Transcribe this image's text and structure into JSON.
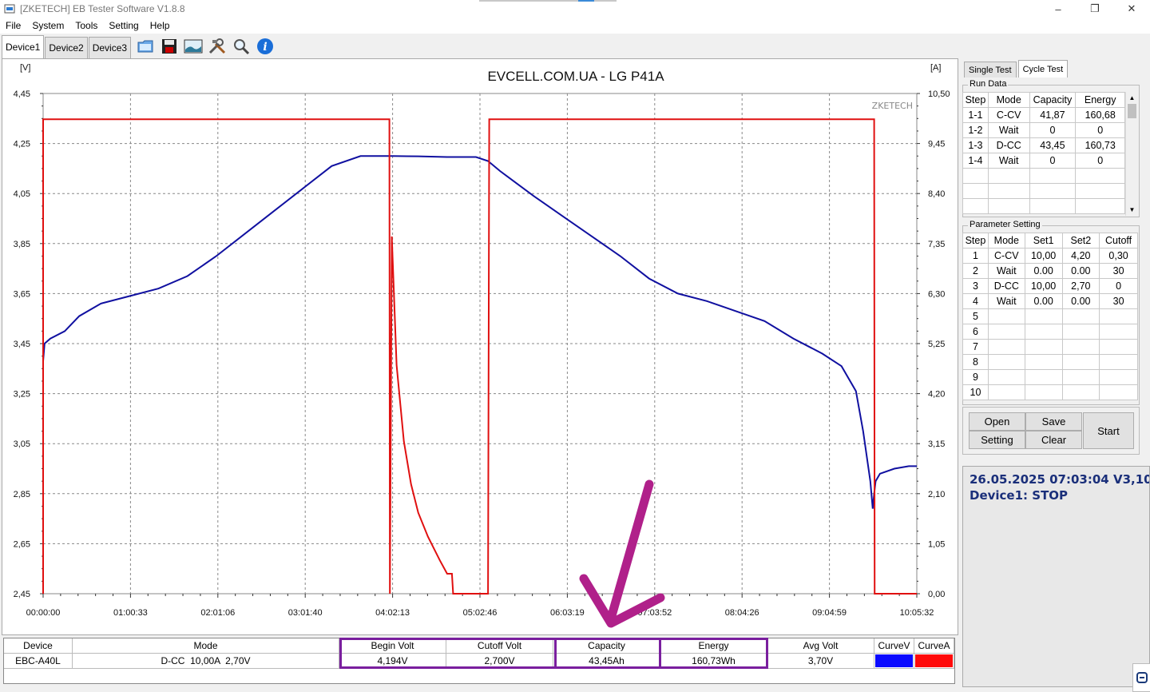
{
  "window": {
    "title": "[ZKETECH] EB Tester Software V1.8.8",
    "controls": [
      "–",
      "❐",
      "✕"
    ]
  },
  "menu": [
    "File",
    "System",
    "Tools",
    "Setting",
    "Help"
  ],
  "device_tabs": [
    "Device1",
    "Device2",
    "Device3"
  ],
  "toolbar_icons": [
    "folder-icon",
    "save-icon",
    "image-icon",
    "tools-icon",
    "search-icon",
    "info-icon"
  ],
  "colors": {
    "curve_v": "#1010a0",
    "curve_a": "#e01010",
    "curve_v_legend": "#0a0aff",
    "curve_a_legend": "#ff0a0a",
    "highlight": "#7a1f9e",
    "arrow": "#b0208a"
  },
  "chart_data": {
    "type": "line",
    "title": "EVCELL.COM.UA - LG P41A",
    "watermark": "ZKETECH",
    "ylabel": "[V]",
    "y2label": "[A]",
    "ylim": [
      2.45,
      4.45
    ],
    "y2lim": [
      0,
      10.5
    ],
    "yticks": [
      "4,45",
      "4,25",
      "4,05",
      "3,85",
      "3,65",
      "3,45",
      "3,25",
      "3,05",
      "2,85",
      "2,65",
      "2,45"
    ],
    "y2ticks": [
      "10,50",
      "9,45",
      "8,40",
      "7,35",
      "6,30",
      "5,25",
      "4,20",
      "3,15",
      "2,10",
      "1,05",
      "0,00"
    ],
    "xticks": [
      "00:00:00",
      "01:00:33",
      "02:01:06",
      "03:01:40",
      "04:02:13",
      "05:02:46",
      "06:03:19",
      "07:03:52",
      "08:04:26",
      "09:04:59",
      "10:05:32"
    ],
    "xlim_seconds": [
      0,
      36332
    ],
    "grid": true,
    "series": [
      {
        "axis": "left",
        "x": [
          0,
          60,
          300,
          900,
          1500,
          2400,
          3600,
          4800,
          6000,
          7200,
          8400,
          9600,
          10800,
          12000,
          13200,
          14400,
          14500,
          15600,
          16800,
          17300,
          18000,
          18500,
          19000,
          19700,
          20400,
          21600,
          22800,
          24000,
          25200,
          26400,
          27600,
          28800,
          30000,
          31200,
          32400,
          33200,
          33800,
          34100,
          34400,
          34500,
          34560,
          34620,
          34800,
          35400,
          36000,
          36332
        ],
        "y": [
          3.38,
          3.45,
          3.47,
          3.5,
          3.56,
          3.61,
          3.64,
          3.67,
          3.72,
          3.8,
          3.89,
          3.98,
          4.07,
          4.16,
          4.2,
          4.2,
          4.2,
          4.199,
          4.196,
          4.196,
          4.196,
          4.18,
          4.14,
          4.09,
          4.04,
          3.96,
          3.88,
          3.8,
          3.71,
          3.65,
          3.62,
          3.58,
          3.54,
          3.47,
          3.41,
          3.36,
          3.26,
          3.1,
          2.9,
          2.79,
          2.85,
          2.9,
          2.93,
          2.95,
          2.96,
          2.96
        ]
      },
      {
        "axis": "right",
        "x": [
          0,
          0,
          14400,
          14420,
          14500,
          14700,
          15000,
          15300,
          15600,
          16000,
          16500,
          16800,
          17000,
          17050,
          17100,
          18500,
          18550,
          34560,
          34580,
          36332
        ],
        "y": [
          0,
          9.96,
          9.96,
          0,
          7.5,
          4.8,
          3.2,
          2.3,
          1.7,
          1.2,
          0.7,
          0.42,
          0.42,
          0,
          0,
          0,
          9.96,
          9.96,
          0,
          0
        ]
      }
    ]
  },
  "bottom_table": {
    "headers": [
      "Device",
      "Mode",
      "Begin Volt",
      "Cutoff Volt",
      "Capacity",
      "Energy",
      "Avg Volt",
      "CurveV",
      "CurveA"
    ],
    "row": [
      "EBC-A40L",
      "D-CC  10,00A  2,70V",
      "4,194V",
      "2,700V",
      "43,45Ah",
      "160,73Wh",
      "3,70V",
      "",
      ""
    ]
  },
  "right_tabs": [
    "Single Test",
    "Cycle Test"
  ],
  "run_data": {
    "title": "Run Data",
    "headers": [
      "Step",
      "Mode",
      "Capacity",
      "Energy"
    ],
    "rows": [
      [
        "1-1",
        "C-CV",
        "41,87",
        "160,68"
      ],
      [
        "1-2",
        "Wait",
        "0",
        "0"
      ],
      [
        "1-3",
        "D-CC",
        "43,45",
        "160,73"
      ],
      [
        "1-4",
        "Wait",
        "0",
        "0"
      ]
    ]
  },
  "param_setting": {
    "title": "Parameter Setting",
    "headers": [
      "Step",
      "Mode",
      "Set1",
      "Set2",
      "Cutoff"
    ],
    "rows": [
      [
        "1",
        "C-CV",
        "10,00",
        "4,20",
        "0,30"
      ],
      [
        "2",
        "Wait",
        "0.00",
        "0.00",
        "30"
      ],
      [
        "3",
        "D-CC",
        "10,00",
        "2,70",
        "0"
      ],
      [
        "4",
        "Wait",
        "0.00",
        "0.00",
        "30"
      ],
      [
        "5",
        "",
        "",
        "",
        ""
      ],
      [
        "6",
        "",
        "",
        "",
        ""
      ],
      [
        "7",
        "",
        "",
        "",
        ""
      ],
      [
        "8",
        "",
        "",
        "",
        ""
      ],
      [
        "9",
        "",
        "",
        "",
        ""
      ],
      [
        "10",
        "",
        "",
        "",
        ""
      ]
    ]
  },
  "buttons": {
    "open": "Open",
    "save": "Save",
    "setting": "Setting",
    "clear": "Clear",
    "start": "Start"
  },
  "status": {
    "line1": "26.05.2025 07:03:04  V3,10",
    "line2": "Device1: STOP"
  }
}
